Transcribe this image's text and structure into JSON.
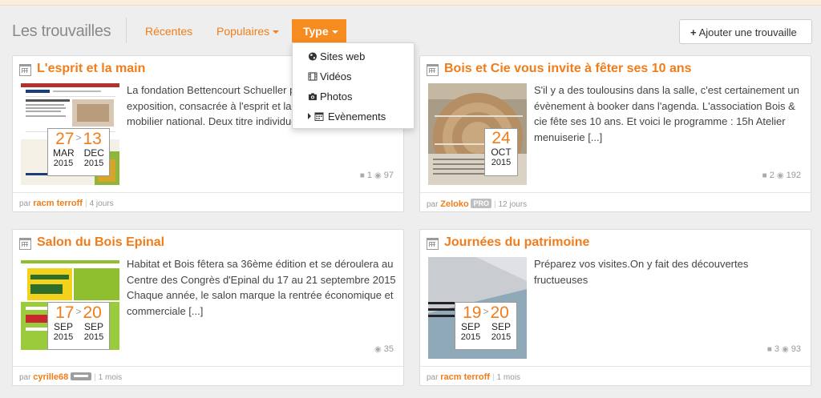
{
  "header": {
    "title": "Les trouvailles",
    "nav": [
      {
        "label": "Récentes"
      },
      {
        "label": "Populaires"
      },
      {
        "label": "Type"
      }
    ],
    "add_button": "Ajouter une trouvaille"
  },
  "dropdown": {
    "items": [
      {
        "label": "Sites web",
        "icon": "globe-icon"
      },
      {
        "label": "Vidéos",
        "icon": "film-icon"
      },
      {
        "label": "Photos",
        "icon": "camera-icon"
      },
      {
        "label": "Evènements",
        "icon": "calendar-icon",
        "has_submenu": true
      }
    ]
  },
  "cards": [
    {
      "title": "L'esprit et la main",
      "excerpt": "La fondation Bettencourt Schueller présente une exposition, consacrée à l'esprit et la main, prestigieux du mobilier national. Deux titre individuel [...]",
      "date": {
        "start_day": "27",
        "end_day": "13",
        "start_month": "MAR",
        "end_month": "DEC",
        "start_year": "2015",
        "end_year": "2015"
      },
      "stats": {
        "comments": "1",
        "views": "97"
      },
      "author": "racm terroff",
      "time": "4 jours"
    },
    {
      "title": "Bois et Cie vous invite à fêter ses 10 ans",
      "excerpt": "S'il y a des toulousins dans la salle, c'est certainement un évènement à booker dans l'agenda. L'association Bois & cie fête ses 10 ans. Et voici le programme : 15h Atelier menuiserie [...]",
      "date": {
        "day": "24",
        "month": "OCT",
        "year": "2015"
      },
      "stats": {
        "comments": "2",
        "views": "192"
      },
      "author": "Zeloko",
      "badge": "PRO",
      "time": "12 jours"
    },
    {
      "title": "Salon du Bois Epinal",
      "excerpt": "Habitat et Bois fêtera sa 36ème édition et se déroulera au Centre des Congrès d'Epinal du 17 au 21 septembre 2015 Chaque année, le salon marque la rentrée économique et commerciale [...]",
      "date": {
        "start_day": "17",
        "end_day": "20",
        "start_month": "SEP",
        "end_month": "SEP",
        "start_year": "2015",
        "end_year": "2015"
      },
      "stats": {
        "views": "35"
      },
      "author": "cyrille68",
      "time": "1 mois"
    },
    {
      "title": "Journées du patrimoine",
      "excerpt": "Préparez vos visites.On y fait des découvertes fructueuses",
      "date": {
        "start_day": "19",
        "end_day": "20",
        "start_month": "SEP",
        "end_month": "SEP",
        "start_year": "2015",
        "end_year": "2015"
      },
      "stats": {
        "comments": "3",
        "views": "93"
      },
      "author": "racm terroff",
      "time": "1 mois"
    }
  ],
  "labels": {
    "by": "par"
  },
  "colors": {
    "accent": "#f07d1a",
    "type_button": "#f68b1f"
  }
}
